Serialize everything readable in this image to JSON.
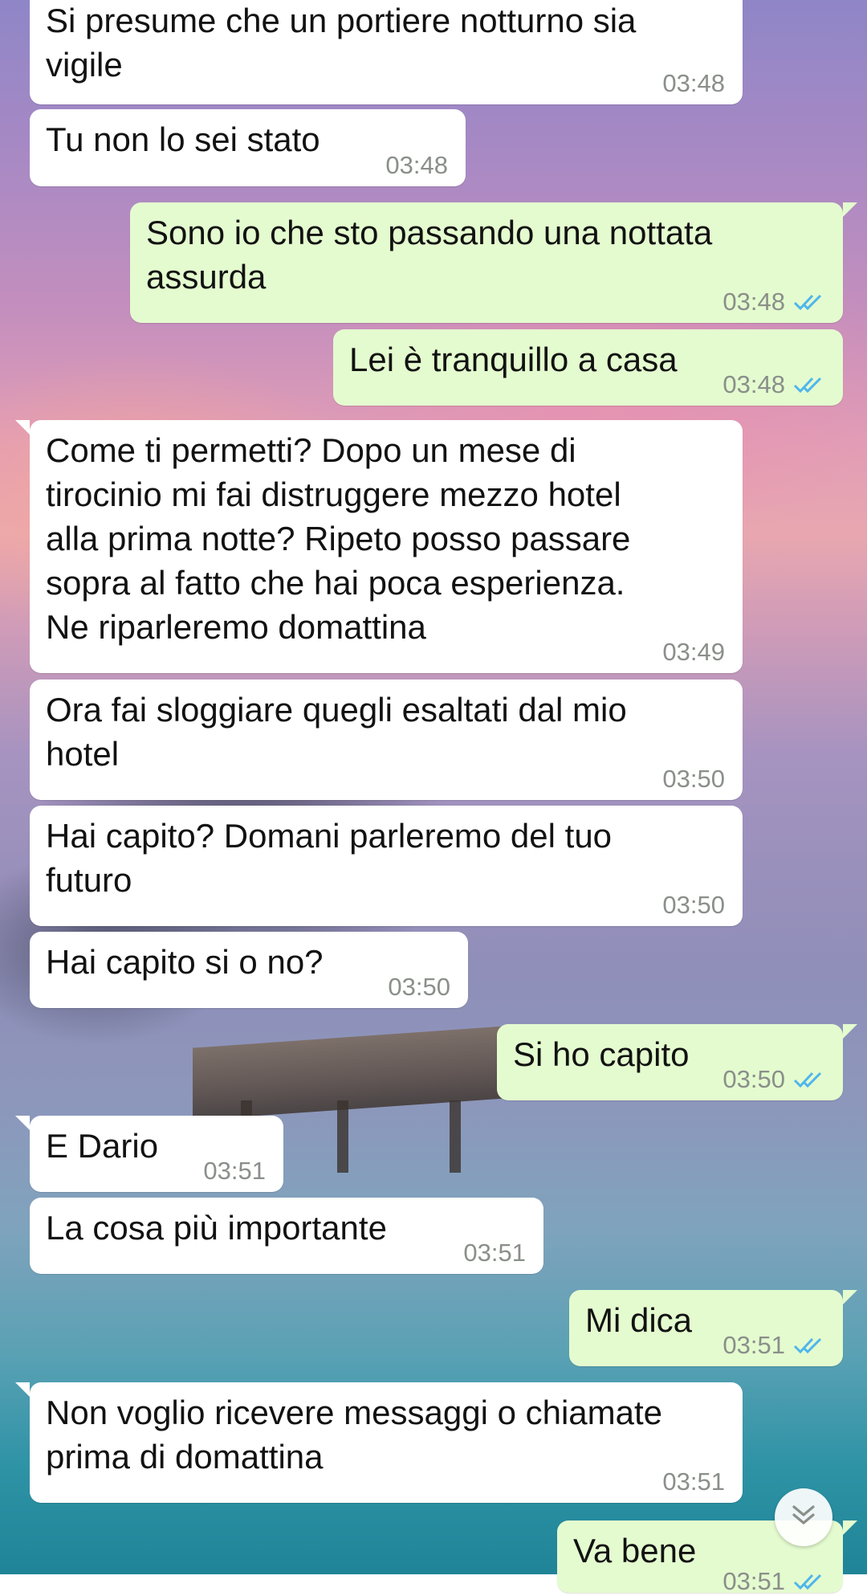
{
  "messages": [
    {
      "direction": "in",
      "text": "Si presume che un portiere notturno sia\nvigile",
      "time": "03:48"
    },
    {
      "direction": "in",
      "text": "Tu non lo sei stato",
      "time": "03:48"
    },
    {
      "direction": "out",
      "text": "Sono io che sto passando una nottata\nassurda",
      "time": "03:48",
      "status": "read"
    },
    {
      "direction": "out",
      "text": "Lei è tranquillo a casa",
      "time": "03:48",
      "status": "read"
    },
    {
      "direction": "in",
      "text": "Come ti permetti? Dopo un mese di\ntirocinio mi fai distruggere mezzo hotel\nalla prima notte? Ripeto posso passare\nsopra al fatto che hai poca esperienza.\nNe riparleremo domattina",
      "time": "03:49"
    },
    {
      "direction": "in",
      "text": "Ora fai sloggiare quegli esaltati dal mio\nhotel",
      "time": "03:50"
    },
    {
      "direction": "in",
      "text": "Hai capito? Domani parleremo del tuo\nfuturo",
      "time": "03:50"
    },
    {
      "direction": "in",
      "text": "Hai capito si o no?",
      "time": "03:50"
    },
    {
      "direction": "out",
      "text": "Si ho capito",
      "time": "03:50",
      "status": "read"
    },
    {
      "direction": "in",
      "text": "E Dario",
      "time": "03:51"
    },
    {
      "direction": "in",
      "text": "La cosa più importante",
      "time": "03:51"
    },
    {
      "direction": "out",
      "text": "Mi dica",
      "time": "03:51",
      "status": "read"
    },
    {
      "direction": "in",
      "text": "Non voglio ricevere messaggi o chiamate\nprima di domattina",
      "time": "03:51"
    },
    {
      "direction": "out",
      "text": "Va bene",
      "time": "03:51",
      "status": "read"
    }
  ],
  "icons": {
    "read_receipt": "double-check-icon",
    "scroll_down": "chevron-double-down-icon"
  },
  "colors": {
    "incoming_bubble": "#ffffff",
    "outgoing_bubble": "#e4fbcf",
    "timestamp": "#8a8f8a",
    "read_ticks": "#4fb6ec"
  }
}
